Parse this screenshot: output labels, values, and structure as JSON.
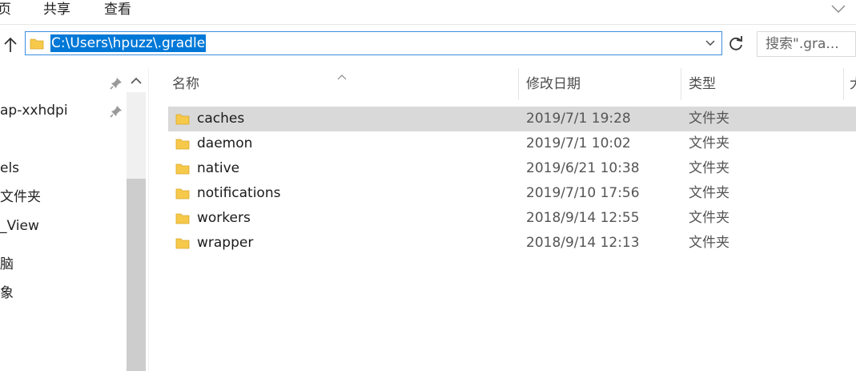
{
  "ribbon": {
    "tabs": [
      "页",
      "共享",
      "查看"
    ]
  },
  "address": {
    "path": "C:\\Users\\hpuzz\\.gradle",
    "search_placeholder": "搜索\".gra..."
  },
  "nav": {
    "items": [
      "",
      "ap-xxhdpi",
      "els",
      "文件夹",
      "_View",
      "脑",
      "象"
    ]
  },
  "columns": {
    "name": "名称",
    "date": "修改日期",
    "type": "类型",
    "size": "大"
  },
  "files": [
    {
      "name": "caches",
      "date": "2019/7/1 19:28",
      "type": "文件夹",
      "selected": true
    },
    {
      "name": "daemon",
      "date": "2019/7/1 10:02",
      "type": "文件夹",
      "selected": false
    },
    {
      "name": "native",
      "date": "2019/6/21 10:38",
      "type": "文件夹",
      "selected": false
    },
    {
      "name": "notifications",
      "date": "2019/7/10 17:56",
      "type": "文件夹",
      "selected": false
    },
    {
      "name": "workers",
      "date": "2018/9/14 12:55",
      "type": "文件夹",
      "selected": false
    },
    {
      "name": "wrapper",
      "date": "2018/9/14 12:13",
      "type": "文件夹",
      "selected": false
    }
  ],
  "colors": {
    "selection": "#0078d7",
    "row_selected": "#d9d9d9",
    "folder": "#f7c94a"
  }
}
